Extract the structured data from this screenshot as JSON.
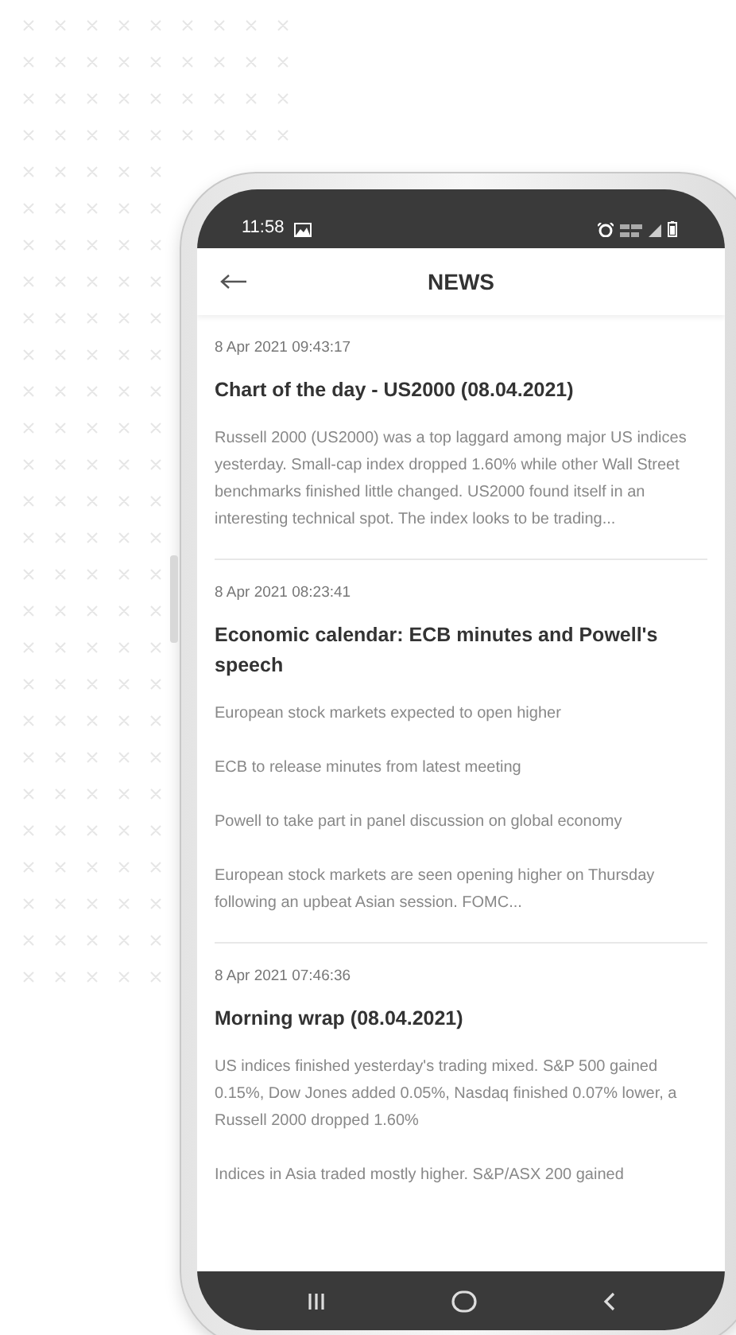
{
  "status_bar": {
    "time": "11:58"
  },
  "header": {
    "title": "NEWS"
  },
  "articles": [
    {
      "timestamp": "8 Apr 2021 09:43:17",
      "title": "Chart of the day - US2000 (08.04.2021)",
      "paragraphs": [
        "Russell 2000 (US2000) was a top laggard among major US indices yesterday. Small-cap index dropped 1.60% while other Wall Street benchmarks finished little changed. US2000 found itself in an interesting technical spot. The index looks to be trading..."
      ]
    },
    {
      "timestamp": "8 Apr 2021 08:23:41",
      "title": "Economic calendar: ECB minutes and Powell's speech",
      "paragraphs": [
        "European stock markets expected to open higher",
        "ECB to release minutes from latest meeting",
        "Powell to take part in panel discussion on global economy",
        "European stock markets are seen opening higher on Thursday following an upbeat Asian session. FOMC..."
      ]
    },
    {
      "timestamp": "8 Apr 2021 07:46:36",
      "title": "Morning wrap (08.04.2021)",
      "paragraphs": [
        "US indices finished yesterday's trading mixed. S&P 500 gained 0.15%, Dow Jones added 0.05%, Nasdaq finished 0.07% lower, a Russell 2000 dropped 1.60%",
        "Indices in Asia traded mostly higher. S&P/ASX 200 gained"
      ]
    }
  ]
}
